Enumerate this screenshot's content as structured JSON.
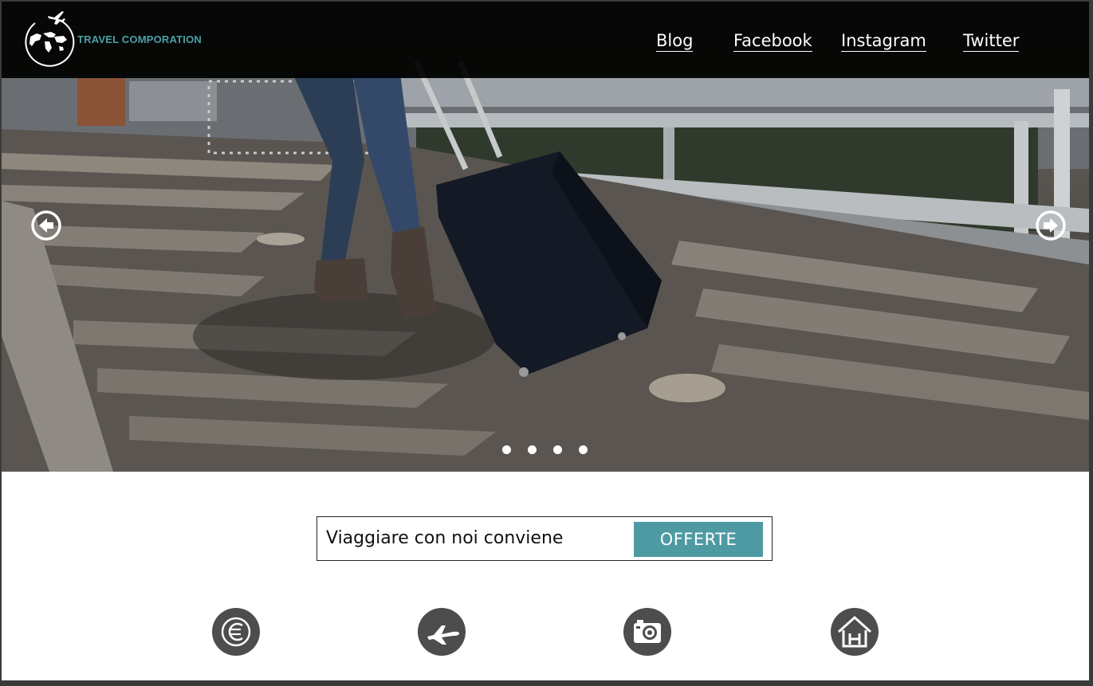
{
  "brand": {
    "name": "TRAVEL COMPORATION",
    "logo_icon": "globe-plane-logo-icon"
  },
  "nav": {
    "items": [
      "Blog",
      "Facebook",
      "Instagram",
      "Twitter"
    ]
  },
  "slider": {
    "prev_icon": "arrow-left-circle-icon",
    "next_icon": "arrow-right-circle-icon",
    "slide_count": 4
  },
  "cta": {
    "text": "Viaggiare con noi conviene",
    "button": "OFFERTE"
  },
  "features": [
    {
      "icon": "euro-icon"
    },
    {
      "icon": "airplane-icon"
    },
    {
      "icon": "camera-icon"
    },
    {
      "icon": "hotel-icon"
    }
  ],
  "colors": {
    "accent": "#4e9aa3",
    "brand_text": "#4aa0a8",
    "topbar": "#000000",
    "feature_icon_bg": "#4d4d4d"
  }
}
